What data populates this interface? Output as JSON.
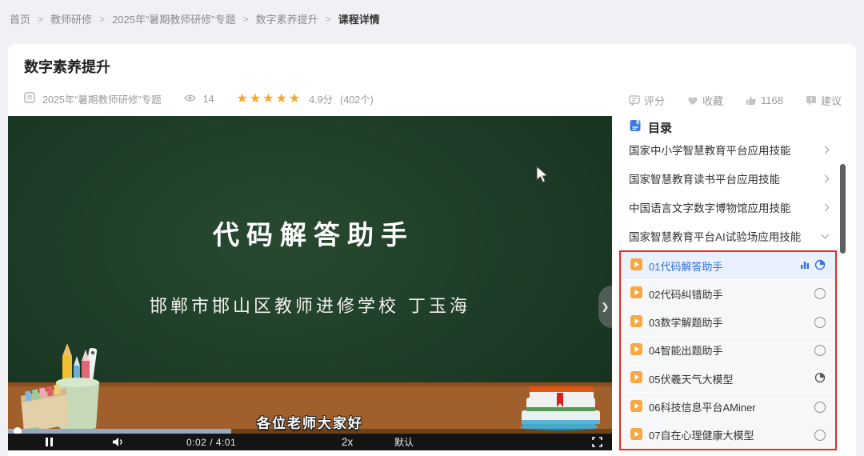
{
  "breadcrumb": {
    "separator": ">",
    "items": [
      "首页",
      "教师研修",
      "2025年“暑期教师研修”专题",
      "数字素养提升",
      "课程详情"
    ]
  },
  "course": {
    "title": "数字素养提升",
    "topic": "2025年“暑期教师研修”专题",
    "views": "14",
    "stars_text": "★★★★★",
    "rating": "4.9分",
    "rating_count": "(402个)"
  },
  "actions": {
    "rate": "评分",
    "favorite": "收藏",
    "likes": "1168",
    "suggest": "建议"
  },
  "video": {
    "slide_title": "代码解答助手",
    "slide_subtitle": "邯郸市邯山区教师进修学校  丁玉海",
    "caption": "各位老师大家好",
    "time": "0:02 / 4:01",
    "speed": "2x",
    "quality": "默认",
    "buffered_percent": 37,
    "played_percent": 1
  },
  "toc": {
    "header": "目录",
    "groups": [
      {
        "label": "国家中小学智慧教育平台应用技能",
        "state": "collapsed"
      },
      {
        "label": "国家智慧教育读书平台应用技能",
        "state": "collapsed"
      },
      {
        "label": "中国语言文字数字博物馆应用技能",
        "state": "collapsed"
      },
      {
        "label": "国家智慧教育平台AI试验场应用技能",
        "state": "expanded"
      }
    ],
    "lessons": [
      {
        "label": "01代码解答助手",
        "status": "playing"
      },
      {
        "label": "02代码纠错助手",
        "status": "not-started"
      },
      {
        "label": "03数学解题助手",
        "status": "not-started"
      },
      {
        "label": "04智能出题助手",
        "status": "not-started"
      },
      {
        "label": "05伏羲天气大模型",
        "status": "in-progress"
      },
      {
        "label": "06科技信息平台AMiner",
        "status": "not-started"
      },
      {
        "label": "07自在心理健康大模型",
        "status": "not-started"
      }
    ]
  },
  "colors": {
    "accent_blue": "#3370de",
    "highlight_red": "#f0261b",
    "star_orange": "#f7a52b",
    "lesson_icon_orange": "#f6a844"
  }
}
